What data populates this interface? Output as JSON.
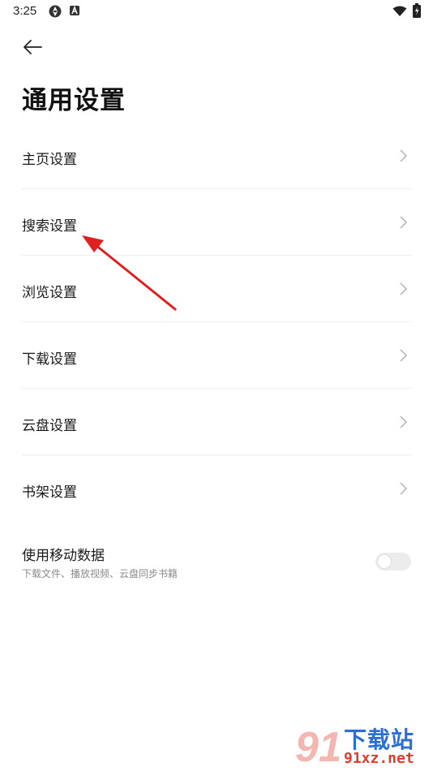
{
  "status_bar": {
    "time": "3:25",
    "icons": [
      "sync-icon",
      "a-badge-icon",
      "wifi-icon",
      "battery-charging-icon"
    ]
  },
  "header": {
    "back_icon": "back-arrow-icon",
    "title": "通用设置"
  },
  "settings": {
    "items": [
      {
        "label": "主页设置",
        "icon": "chevron-right-icon"
      },
      {
        "label": "搜索设置",
        "icon": "chevron-right-icon"
      },
      {
        "label": "浏览设置",
        "icon": "chevron-right-icon"
      },
      {
        "label": "下载设置",
        "icon": "chevron-right-icon"
      },
      {
        "label": "云盘设置",
        "icon": "chevron-right-icon"
      },
      {
        "label": "书架设置",
        "icon": "chevron-right-icon"
      }
    ]
  },
  "mobile_data": {
    "title": "使用移动数据",
    "subtitle": "下载文件、播放视频、云盘同步书籍",
    "enabled": false
  },
  "annotation": {
    "color": "#e02020"
  },
  "watermark": {
    "logo_text": "91",
    "name": "下载站",
    "url": "91xz.net"
  }
}
